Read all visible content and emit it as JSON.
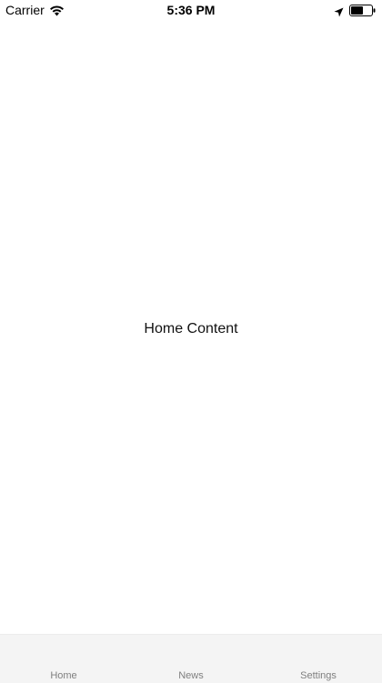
{
  "status_bar": {
    "carrier": "Carrier",
    "time": "5:36 PM",
    "icons": [
      "wifi-icon",
      "location-icon",
      "battery-icon"
    ]
  },
  "main": {
    "content_text": "Home Content"
  },
  "tab_bar": {
    "tabs": [
      {
        "label": "Home"
      },
      {
        "label": "News"
      },
      {
        "label": "Settings"
      }
    ]
  },
  "colors": {
    "background": "#ffffff",
    "tab_bar_background": "#f4f4f4",
    "tab_label": "#7f7f7f"
  }
}
